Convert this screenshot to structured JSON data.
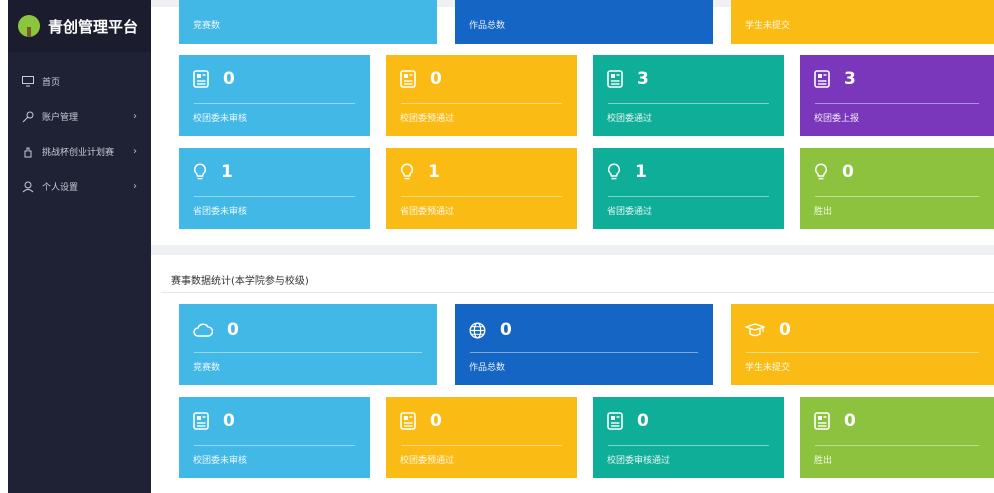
{
  "app": {
    "name": "青创管理平台"
  },
  "sidebar": {
    "items": [
      {
        "label": "首页",
        "icon": "monitor-icon",
        "has_arrow": false
      },
      {
        "label": "账户管理",
        "icon": "key-icon",
        "has_arrow": true
      },
      {
        "label": "挑战杯创业计划赛",
        "icon": "hand-icon",
        "has_arrow": true
      },
      {
        "label": "个人设置",
        "icon": "user-icon",
        "has_arrow": true
      }
    ],
    "arrow": "›"
  },
  "top_section": {
    "cut_row": [
      "竞赛数",
      "作品总数",
      "学生未提交"
    ],
    "row1": [
      {
        "value": "0",
        "label": "校团委未审核",
        "icon": "newspaper-icon",
        "color": "#42b8e6"
      },
      {
        "value": "0",
        "label": "校团委预通过",
        "icon": "newspaper-icon",
        "color": "#fbbb15"
      },
      {
        "value": "3",
        "label": "校团委通过",
        "icon": "newspaper-icon",
        "color": "#0fae99"
      },
      {
        "value": "3",
        "label": "校团委上报",
        "icon": "newspaper-icon",
        "color": "#7a37bb"
      }
    ],
    "row2": [
      {
        "value": "1",
        "label": "省团委未审核",
        "icon": "bulb-icon",
        "color": "#42b8e6"
      },
      {
        "value": "1",
        "label": "省团委预通过",
        "icon": "bulb-icon",
        "color": "#fbbb15"
      },
      {
        "value": "1",
        "label": "省团委通过",
        "icon": "bulb-icon",
        "color": "#0fae99"
      },
      {
        "value": "0",
        "label": "胜出",
        "icon": "bulb-icon",
        "color": "#8dc23e"
      }
    ]
  },
  "college_section": {
    "title": "赛事数据统计(本学院参与校级)",
    "row1": [
      {
        "value": "0",
        "label": "竞赛数",
        "icon": "cloud-icon",
        "color": "#42b8e6"
      },
      {
        "value": "0",
        "label": "作品总数",
        "icon": "globe-icon",
        "color": "#1565c5"
      },
      {
        "value": "0",
        "label": "学生未提交",
        "icon": "graduation-cap-icon",
        "color": "#fbbb15"
      }
    ],
    "row2": [
      {
        "value": "0",
        "label": "校团委未审核",
        "icon": "newspaper-icon",
        "color": "#42b8e6"
      },
      {
        "value": "0",
        "label": "校团委预通过",
        "icon": "newspaper-icon",
        "color": "#fbbb15"
      },
      {
        "value": "0",
        "label": "校团委审核通过",
        "icon": "newspaper-icon",
        "color": "#0fae99"
      },
      {
        "value": "0",
        "label": "胜出",
        "icon": "newspaper-icon",
        "color": "#8dc23e"
      }
    ]
  }
}
